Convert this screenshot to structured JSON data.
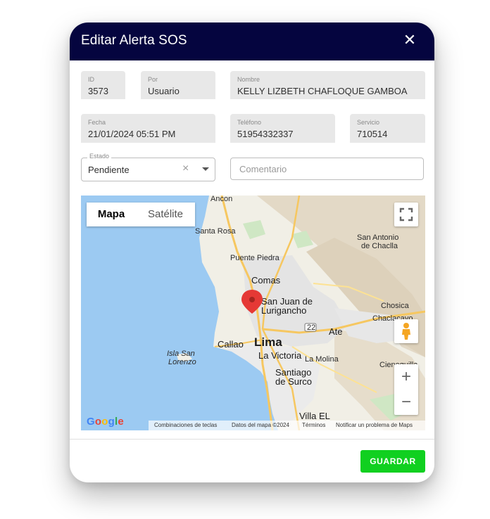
{
  "dialog": {
    "title": "Editar Alerta SOS",
    "close_glyph": "✕"
  },
  "fields": {
    "id": {
      "label": "ID",
      "value": "3573"
    },
    "por": {
      "label": "Por",
      "value": "Usuario"
    },
    "nombre": {
      "label": "Nombre",
      "value": "KELLY LIZBETH CHAFLOQUE GAMBOA"
    },
    "fecha": {
      "label": "Fecha",
      "value": "21/01/2024 05:51 PM"
    },
    "telefono": {
      "label": "Teléfono",
      "value": "51954332337"
    },
    "servicio": {
      "label": "Servicio",
      "value": "710514"
    },
    "estado": {
      "label": "Estado",
      "value": "Pendiente"
    },
    "comentario": {
      "placeholder": "Comentario",
      "value": ""
    }
  },
  "map": {
    "type_map": "Mapa",
    "type_satellite": "Satélite",
    "zoom_in": "+",
    "zoom_out": "−",
    "labels": {
      "ancon": "Ancon",
      "santa_rosa": "Santa Rosa",
      "puente_piedra": "Puente Piedra",
      "san_antonio_1": "San Antonio",
      "san_antonio_2": "de Chaclla",
      "comas": "Comas",
      "sjl_1": "San Juan de",
      "sjl_2": "Lurigancho",
      "chosica": "Chosica",
      "chaclacayo": "Chaclacayo",
      "ate": "Ate",
      "callao": "Callao",
      "lima": "Lima",
      "la_victoria": "La Victoria",
      "la_molina": "La Molina",
      "isla_1": "Isla San",
      "isla_2": "Lorenzo",
      "santiago_1": "Santiago",
      "santiago_2": "de Surco",
      "cieneguilla": "Cieneguilla",
      "villa": "Villa EL",
      "road_22": "22"
    },
    "google": "Google",
    "footer": {
      "shortcuts": "Combinaciones de teclas",
      "data": "Datos del mapa ©2024",
      "terms": "Términos",
      "report": "Notificar un problema de Maps"
    }
  },
  "actions": {
    "save": "GUARDAR"
  },
  "colors": {
    "header": "#05053f",
    "save": "#10d020",
    "water": "#9ccaf2",
    "pin": "#e53935"
  }
}
